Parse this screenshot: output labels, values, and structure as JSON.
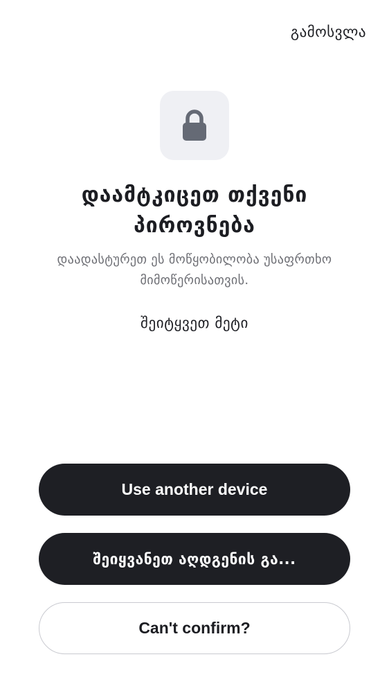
{
  "header": {
    "signout_label": "გამოსვლა"
  },
  "icon": {
    "name": "lock-icon",
    "tile_color": "#eff0f4",
    "glyph_color": "#656a75"
  },
  "content": {
    "title": "დაამტკიცეთ თქვენი პიროვნება",
    "subtitle": "დაადასტურეთ ეს მოწყობილობა უსაფრთხო მიმოწერისათვის.",
    "learn_more": "შეიტყვეთ მეტი"
  },
  "actions": {
    "use_another_device": "Use another device",
    "enter_recovery_key": "შეიყვანეთ აღდგენის გა...",
    "cant_confirm": "Can't confirm?"
  },
  "colors": {
    "primary_button": "#1e1f24",
    "text": "#1c1d22",
    "muted_text": "#6c6d73",
    "outline": "#c9cad0"
  }
}
